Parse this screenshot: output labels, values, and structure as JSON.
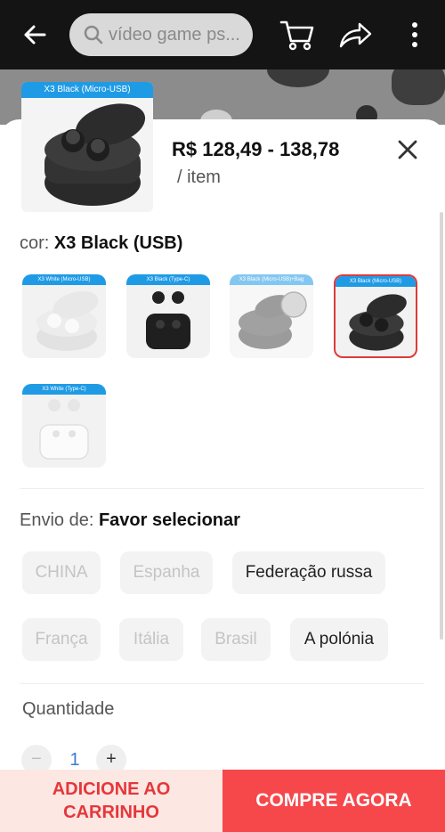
{
  "appbar": {
    "search_placeholder": "vídeo game ps...",
    "icons": [
      "back-arrow-icon",
      "search-icon",
      "cart-icon",
      "share-icon",
      "more-vertical-icon"
    ]
  },
  "product": {
    "main_image_tag": "X3 Black (Micro-USB)",
    "price_range": "R$ 128,49 - 138,78",
    "unit": "/ item"
  },
  "color": {
    "label": "cor:",
    "selected": "X3 Black  (USB)",
    "variants": [
      {
        "tag": "X3 White (Micro-USB)",
        "available": true,
        "selected": false
      },
      {
        "tag": "X3 Black (Type-C)",
        "available": true,
        "selected": false
      },
      {
        "tag": "X3 Black (Micro-USB)+Bag",
        "available": false,
        "selected": false
      },
      {
        "tag": "X3 Black (Micro-USB)",
        "available": true,
        "selected": true
      },
      {
        "tag": "X3 White (Type-C)",
        "available": true,
        "selected": false
      }
    ]
  },
  "shipping": {
    "label": "Envio de:",
    "value": "Favor selecionar",
    "options": [
      {
        "label": "CHINA",
        "available": false
      },
      {
        "label": "Espanha",
        "available": false
      },
      {
        "label": "Federação russa",
        "available": true
      },
      {
        "label": "França",
        "available": false
      },
      {
        "label": "Itália",
        "available": false
      },
      {
        "label": "Brasil",
        "available": false
      },
      {
        "label": "A polónia",
        "available": true
      }
    ]
  },
  "quantity": {
    "label": "Quantidade",
    "value": "1",
    "minus": "−",
    "plus": "+"
  },
  "actions": {
    "add_to_cart": "ADICIONE AO CARRINHO",
    "buy_now": "COMPRE AGORA"
  },
  "colors": {
    "accent": "#f6474b",
    "tag_blue": "#1f9be6",
    "cart_bg": "#fde7e3",
    "qty_blue": "#3a7bd5"
  }
}
